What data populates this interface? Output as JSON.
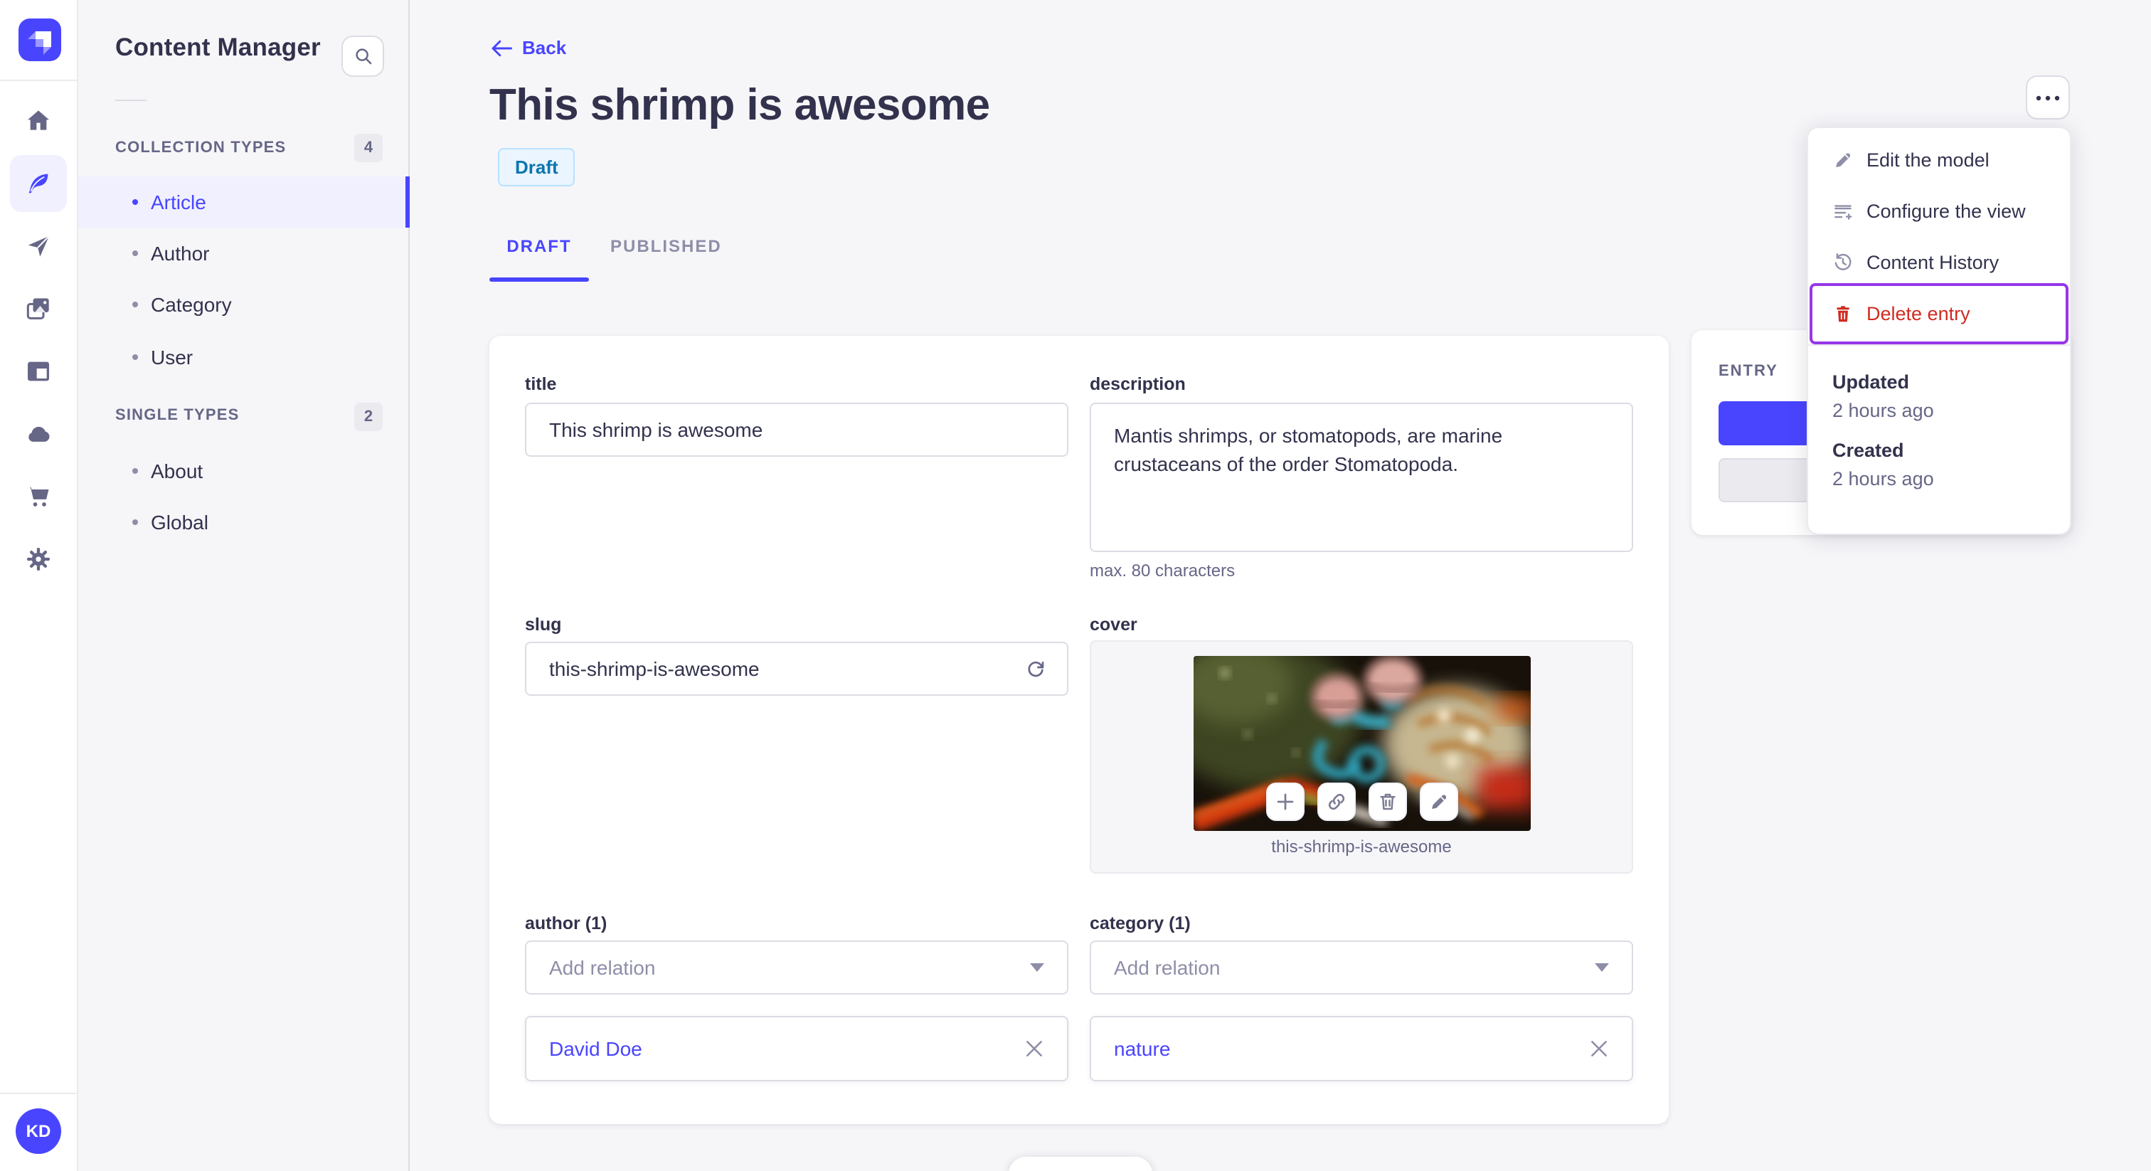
{
  "colors": {
    "primary": "#4945ff",
    "primary_light_bg": "#f0f0ff",
    "danger": "#d02b20",
    "focus_outline": "#9736e8",
    "draft_badge_bg": "#eaf5ff",
    "draft_badge_border": "#b8e1ff",
    "draft_badge_text": "#0c75af",
    "icon_gray": "#666687",
    "muted_text": "#8e8ea9"
  },
  "rail": {
    "workspace_initials": "KD",
    "icons": [
      "strapi-logo",
      "home",
      "content-manager",
      "releases",
      "media-library",
      "content-type-builder",
      "deploy-cloud",
      "marketplace",
      "settings"
    ]
  },
  "subnav": {
    "title": "Content Manager",
    "search_icon": "search",
    "sections": [
      {
        "label": "COLLECTION TYPES",
        "count": "4",
        "items": [
          {
            "label": "Article",
            "active": true
          },
          {
            "label": "Author"
          },
          {
            "label": "Category"
          },
          {
            "label": "User"
          }
        ]
      },
      {
        "label": "SINGLE TYPES",
        "count": "2",
        "items": [
          {
            "label": "About"
          },
          {
            "label": "Global"
          }
        ]
      }
    ]
  },
  "header": {
    "back_label": "Back",
    "title": "This shrimp is awesome",
    "status": "Draft",
    "tabs": [
      {
        "label": "DRAFT",
        "active": true
      },
      {
        "label": "PUBLISHED",
        "active": false
      }
    ]
  },
  "form": {
    "title": {
      "label": "title",
      "value": "This shrimp is awesome"
    },
    "description": {
      "label": "description",
      "value": "Mantis shrimps, or stomatopods, are marine crustaceans of the order Stomatopoda.",
      "hint": "max. 80 characters"
    },
    "slug": {
      "label": "slug",
      "value": "this-shrimp-is-awesome",
      "action_icon": "regenerate"
    },
    "cover": {
      "label": "cover",
      "caption": "this-shrimp-is-awesome",
      "action_icons": [
        "add",
        "copy-link",
        "delete",
        "edit"
      ]
    },
    "author": {
      "label": "author (1)",
      "placeholder": "Add relation",
      "relation": "David Doe"
    },
    "category": {
      "label": "category (1)",
      "placeholder": "Add relation",
      "relation": "nature"
    }
  },
  "entry_panel": {
    "title": "ENTRY"
  },
  "menu": {
    "items": [
      {
        "label": "Edit the model",
        "icon": "pencil"
      },
      {
        "label": "Configure the view",
        "icon": "configure-list"
      },
      {
        "label": "Content History",
        "icon": "history-clock"
      },
      {
        "label": "Delete entry",
        "icon": "trash",
        "danger": true,
        "focused": true
      }
    ],
    "meta": [
      {
        "label": "Updated",
        "value": "2 hours ago"
      },
      {
        "label": "Created",
        "value": "2 hours ago"
      }
    ]
  }
}
